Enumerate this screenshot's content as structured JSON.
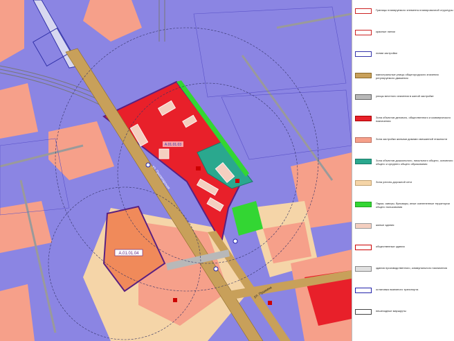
{
  "map": {
    "district_label": "А.01.01.04",
    "road_label": "ул. Пролетарская",
    "road_label_2": "ул. Пушкина",
    "block_label": "А.01.01.03"
  },
  "legend": {
    "items": [
      {
        "text": "Границы планируемого элемента планировочной структуры",
        "color": "#ffffff",
        "border": "#cc2222"
      },
      {
        "text": "красные линии",
        "color": "#ffffff",
        "border": "#cc2222"
      },
      {
        "text": "линии застройки",
        "color": "#ffffff",
        "border": "#3333aa"
      },
      {
        "text": "магистральные улицы общегородского значения регулируемого движения",
        "color": "#c8a05a",
        "border": "#8a6a2a"
      },
      {
        "text": "улицы местного значения в жилой застройке",
        "color": "#b8b8b8",
        "border": "#666666"
      },
      {
        "text": "Зона объектов делового, общественного и коммерческого назначения",
        "color": "#e8202a",
        "border": "#aa0000"
      },
      {
        "text": "Зона застройки жилыми домами смешанной этажности",
        "color": "#f6a08a",
        "border": "#c07060"
      },
      {
        "text": "Зона объектов дошкольного, начального общего, основного общего и среднего общего образования",
        "color": "#2aa88e",
        "border": "#1a7a66"
      },
      {
        "text": "Зона улично-дорожной сети",
        "color": "#f5d5a8",
        "border": "#c0a070"
      },
      {
        "text": "Парки, скверы, бульвары, иные озелененные территории общего пользования",
        "color": "#33d633",
        "border": "#22a022"
      },
      {
        "text": "жилые здания",
        "color": "#f4cfc0",
        "border": "#999999"
      },
      {
        "text": "общественные здания",
        "color": "#ffffff",
        "border": "#cc0000"
      },
      {
        "text": "здания производственного, коммунального назначения",
        "color": "#e0e0e0",
        "border": "#888888"
      },
      {
        "text": "остановка наземного транспорта",
        "color": "#ffffff",
        "border": "#2222aa"
      },
      {
        "text": "пешеходные маршруты",
        "color": "#ffffff",
        "border": "#444444"
      }
    ]
  },
  "colors": {
    "industrial": "#8b85e3",
    "business": "#e8202a",
    "residential": "#f6a08a",
    "school": "#2aa88e",
    "road": "#c8a05a",
    "green": "#33d633",
    "street_zone": "#f5d5a8"
  }
}
